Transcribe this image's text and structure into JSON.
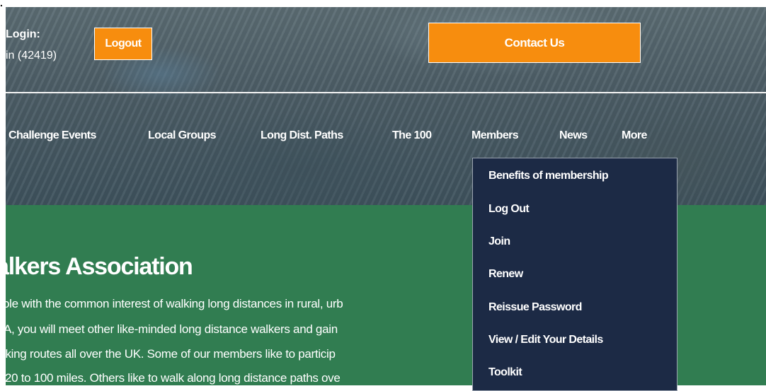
{
  "header": {
    "login_label": "Login:",
    "login_user": "in (42419)",
    "logout_label": "Logout",
    "contact_label": "Contact Us"
  },
  "nav": {
    "items": [
      {
        "label": "Challenge Events"
      },
      {
        "label": "Local Groups"
      },
      {
        "label": "Long Dist. Paths"
      },
      {
        "label": "The 100"
      },
      {
        "label": "Members"
      },
      {
        "label": "News"
      },
      {
        "label": "More"
      }
    ]
  },
  "members_menu": {
    "items": [
      {
        "label": "Benefits of membership"
      },
      {
        "label": "Log Out"
      },
      {
        "label": "Join"
      },
      {
        "label": "Renew"
      },
      {
        "label": "Reissue Password"
      },
      {
        "label": "View / Edit Your Details"
      },
      {
        "label": "Toolkit"
      }
    ]
  },
  "main": {
    "title": "alkers Association",
    "paragraph_lines": [
      "ole with the common interest of walking long distances in rural, urb",
      "A, you will meet other like-minded long distance walkers and gain",
      "lking routes all over the UK. Some of our members like to particip",
      "20 to 100 miles. Others like to walk along long distance paths ove"
    ]
  },
  "colors": {
    "accent_orange": "#f78d0e",
    "green_band": "#317d51",
    "dropdown_bg": "#1c2a45"
  }
}
